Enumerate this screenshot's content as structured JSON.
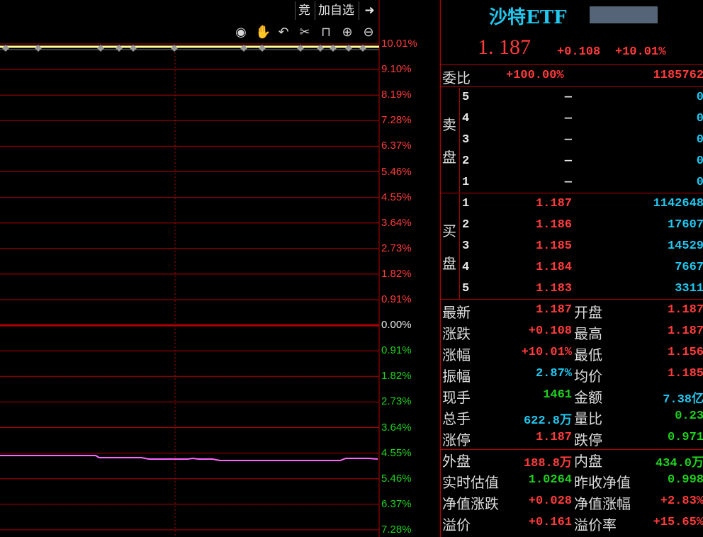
{
  "toolbar": {
    "bid_label": "竞",
    "add_watchlist_label": "加自选",
    "exit_icon": "arrow-right-bar-icon",
    "tools": [
      "eye-icon",
      "hand-icon",
      "undo-icon",
      "scissors-icon",
      "lock-icon",
      "zoom-in-icon",
      "zoom-out-icon"
    ]
  },
  "chart": {
    "axis_labels_up": [
      "10.01%",
      "9.10%",
      "8.19%",
      "7.28%",
      "6.37%",
      "5.46%",
      "4.55%",
      "3.64%",
      "2.73%",
      "1.82%",
      "0.91%"
    ],
    "axis_label_zero": "0.00%",
    "axis_labels_down": [
      "0.91%",
      "1.82%",
      "2.73%",
      "3.64%",
      "4.55%",
      "5.46%",
      "6.37%",
      "7.28%"
    ],
    "colors": {
      "price_line": "#ffff99",
      "avg_line": "#ff66ff",
      "grid": "#b00000",
      "up": "#ff3b3b",
      "down": "#1fd11f"
    }
  },
  "quote": {
    "name": "沙特ETF",
    "price": "1. 187",
    "change": "+0.108",
    "change_pct": "+10.01%",
    "commission_ratio_label": "委比",
    "commission_ratio": "+100.00%",
    "commission_diff": "1185762"
  },
  "orderbook": {
    "sell_label": [
      "卖",
      "盘"
    ],
    "buy_label": [
      "买",
      "盘"
    ],
    "sell": [
      {
        "level": "5",
        "price": "—",
        "vol": "0"
      },
      {
        "level": "4",
        "price": "—",
        "vol": "0"
      },
      {
        "level": "3",
        "price": "—",
        "vol": "0"
      },
      {
        "level": "2",
        "price": "—",
        "vol": "0"
      },
      {
        "level": "1",
        "price": "—",
        "vol": "0"
      }
    ],
    "buy": [
      {
        "level": "1",
        "price": "1.187",
        "vol": "1142648"
      },
      {
        "level": "2",
        "price": "1.186",
        "vol": "17607"
      },
      {
        "level": "3",
        "price": "1.185",
        "vol": "14529"
      },
      {
        "level": "4",
        "price": "1.184",
        "vol": "7667"
      },
      {
        "level": "5",
        "price": "1.183",
        "vol": "3311"
      }
    ]
  },
  "stats": [
    {
      "l1": "最新",
      "v1": "1.187",
      "c1": "red",
      "l2": "开盘",
      "v2": "1.187",
      "c2": "red"
    },
    {
      "l1": "涨跌",
      "v1": "+0.108",
      "c1": "red",
      "l2": "最高",
      "v2": "1.187",
      "c2": "red"
    },
    {
      "l1": "涨幅",
      "v1": "+10.01%",
      "c1": "red",
      "l2": "最低",
      "v2": "1.156",
      "c2": "red"
    },
    {
      "l1": "振幅",
      "v1": "2.87%",
      "c1": "cyan",
      "l2": "均价",
      "v2": "1.185",
      "c2": "red"
    },
    {
      "l1": "现手",
      "v1": "1461",
      "c1": "green",
      "l2": "金额",
      "v2": "7.38亿",
      "c2": "cyan"
    },
    {
      "l1": "总手",
      "v1": "622.8万",
      "c1": "cyan",
      "l2": "量比",
      "v2": "0.23",
      "c2": "green"
    },
    {
      "l1": "涨停",
      "v1": "1.187",
      "c1": "red",
      "l2": "跌停",
      "v2": "0.971",
      "c2": "green"
    }
  ],
  "stats2": [
    {
      "l1": "外盘",
      "v1": "188.8万",
      "c1": "red",
      "l2": "内盘",
      "v2": "434.0万",
      "c2": "green"
    },
    {
      "l1": "实时估值",
      "v1": "1.0264",
      "c1": "green",
      "l2": "昨收净值",
      "v2": "0.998",
      "c2": "green"
    },
    {
      "l1": "净值涨跌",
      "v1": "+0.028",
      "c1": "red",
      "l2": "净值涨幅",
      "v2": "+2.83%",
      "c2": "red"
    },
    {
      "l1": "溢价",
      "v1": "+0.161",
      "c1": "red",
      "l2": "溢价率",
      "v2": "+15.65%",
      "c2": "red"
    }
  ]
}
